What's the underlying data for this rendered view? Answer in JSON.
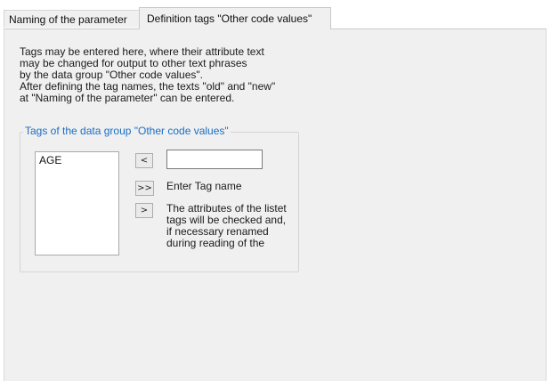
{
  "tabs": [
    {
      "label": "Naming of the parameter",
      "active": false
    },
    {
      "label": "Definition tags \"Other code values\"",
      "active": true
    }
  ],
  "description": {
    "lines": [
      "Tags may be entered here, where their attribute text",
      "may be changed for output to other text phrases",
      "by the data group \"Other code values\".",
      "After defining the tag names, the texts \"old\" and \"new\"",
      "at \"Naming of the parameter\" can be entered."
    ]
  },
  "group": {
    "title": "Tags of the data group \"Other code values\"",
    "title_color": "#1a6fc4",
    "tag_list": [
      "AGE"
    ],
    "buttons": {
      "move_left": "<",
      "move_all": ">>",
      "move_right": ">"
    },
    "tag_name_input": {
      "value": "",
      "placeholder": ""
    },
    "enter_tag_label": "Enter Tag name",
    "note_lines": [
      "The attributes of the listet",
      "tags will be checked and,",
      "if necessary renamed",
      "during reading of the"
    ]
  }
}
